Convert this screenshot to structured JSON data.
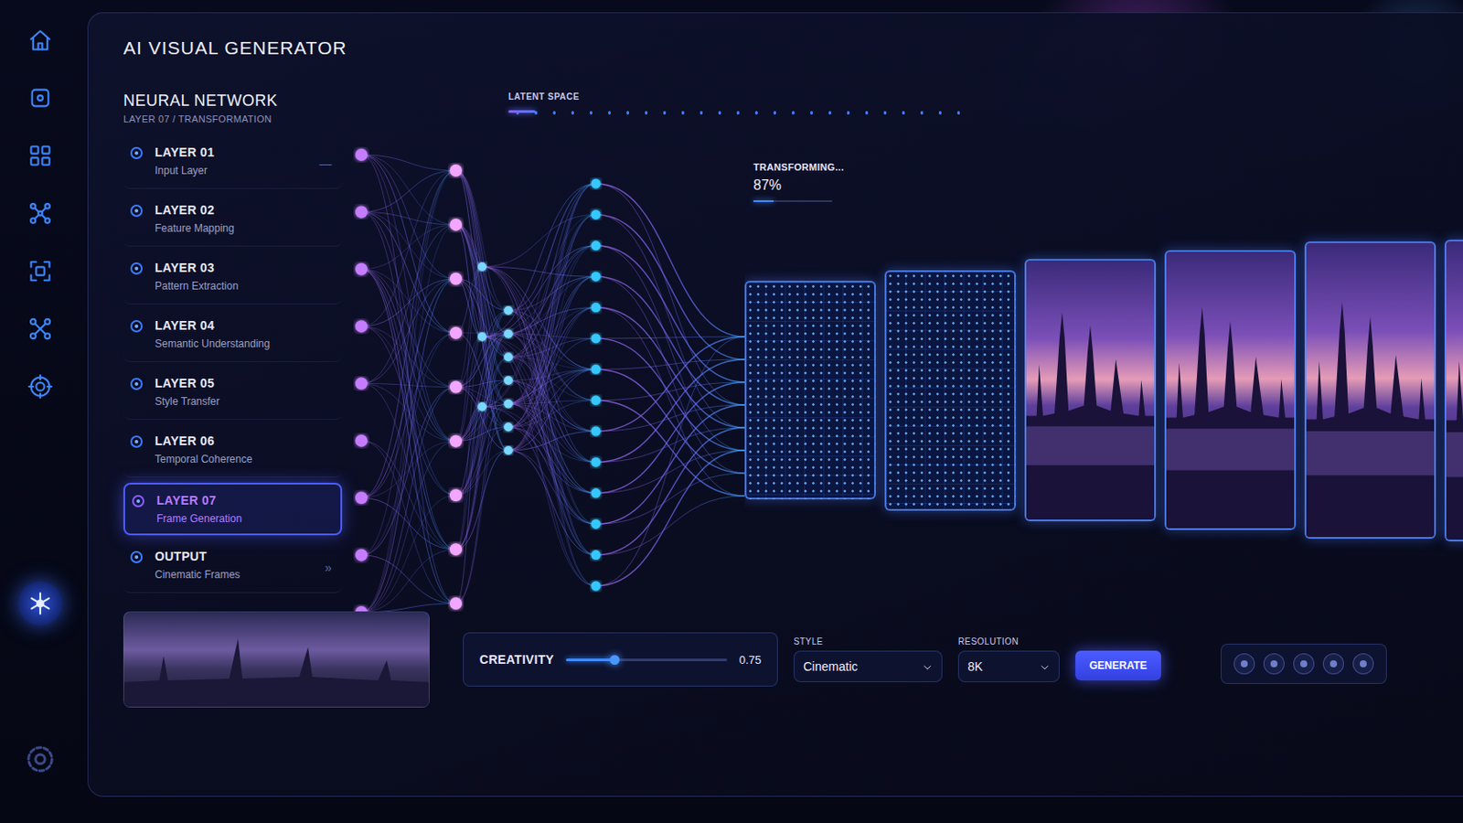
{
  "app": {
    "title": "AI VISUAL GENERATOR"
  },
  "sidebar": {
    "items": [
      {
        "selected": false
      },
      {
        "selected": false
      },
      {
        "selected": false
      },
      {
        "selected": false
      },
      {
        "selected": false
      },
      {
        "selected": false
      },
      {
        "selected": false
      },
      {
        "selected": true
      },
      {
        "selected": false
      }
    ]
  },
  "network": {
    "title": "NEURAL NETWORK",
    "subtitle": "LAYER 07 / TRANSFORMATION",
    "layers": [
      {
        "label": "LAYER 01",
        "description": "Input Layer",
        "selected": false,
        "extra": "—"
      },
      {
        "label": "LAYER 02",
        "description": "Feature Mapping",
        "selected": false
      },
      {
        "label": "LAYER 03",
        "description": "Pattern Extraction",
        "selected": false
      },
      {
        "label": "LAYER 04",
        "description": "Semantic Understanding",
        "selected": false
      },
      {
        "label": "LAYER 05",
        "description": "Style Transfer",
        "selected": false
      },
      {
        "label": "LAYER 06",
        "description": "Temporal Coherence",
        "selected": false
      },
      {
        "label": "LAYER 07",
        "description": "Frame Generation",
        "selected": true
      },
      {
        "label": "OUTPUT",
        "description": "Cinematic Frames",
        "selected": false,
        "extra": "»"
      }
    ]
  },
  "latent_space": {
    "label": "LATENT SPACE",
    "level": 0.06
  },
  "progress": {
    "label": "TRANSFORMING...",
    "reading": "87%",
    "level": 0.25
  },
  "frames": [
    {
      "kind": "wireframe"
    },
    {
      "kind": "wireframe"
    },
    {
      "kind": "render"
    },
    {
      "kind": "render"
    },
    {
      "kind": "render"
    },
    {
      "kind": "render"
    }
  ],
  "controls": {
    "creativity": {
      "label": "CREATIVITY",
      "level": 0.3,
      "reading": "0.75"
    },
    "style": {
      "label": "STYLE",
      "value": "Cinematic"
    },
    "resolution": {
      "label": "RESOLUTION",
      "value": "8K"
    },
    "generate": {
      "label": "GENERATE"
    }
  }
}
